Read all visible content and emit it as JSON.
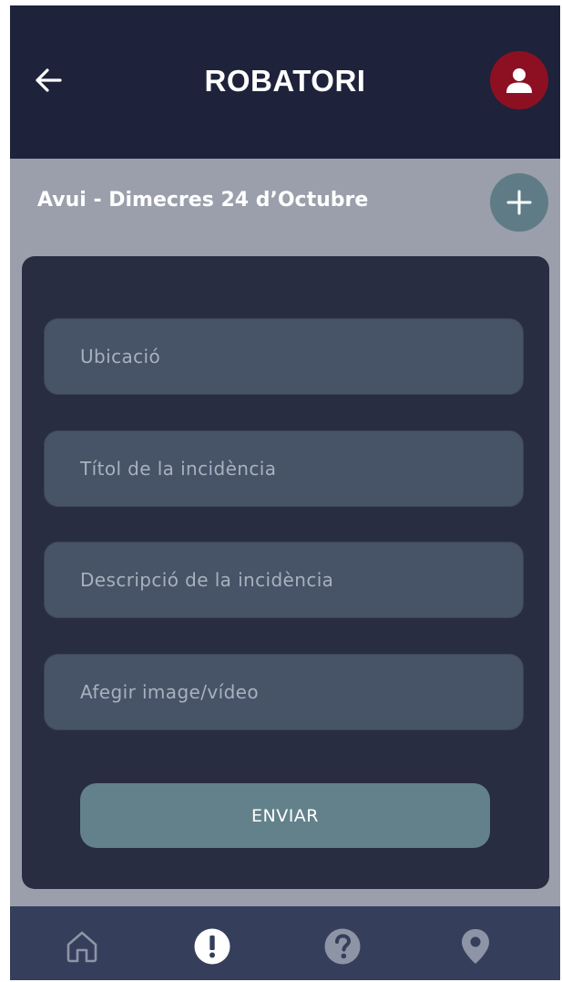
{
  "header": {
    "title": "ROBATORI",
    "back_icon": "arrow-left-icon",
    "profile_icon": "user-icon",
    "profile_color": "#8c1022"
  },
  "date_bar": {
    "label": "Avui - Dimecres 24 d’Octubre",
    "add_icon": "plus-icon"
  },
  "form": {
    "fields": [
      {
        "placeholder": "Ubicació"
      },
      {
        "placeholder": "Títol de la incidència"
      },
      {
        "placeholder": "Descripció de la incidència"
      },
      {
        "placeholder": "Afegir image/vídeo"
      }
    ],
    "submit_label": "ENVIAR"
  },
  "bottom_nav": {
    "items": [
      {
        "icon": "home-icon",
        "active": false
      },
      {
        "icon": "alert-icon",
        "active": true
      },
      {
        "icon": "help-icon",
        "active": false
      },
      {
        "icon": "location-pin-icon",
        "active": false
      }
    ]
  },
  "colors": {
    "header_bg": "#1e223b",
    "page_bg": "#9a9fab",
    "card_bg": "#282d41",
    "field_bg": "#475367",
    "accent": "#63818a",
    "nav_bg": "#353f5c"
  }
}
